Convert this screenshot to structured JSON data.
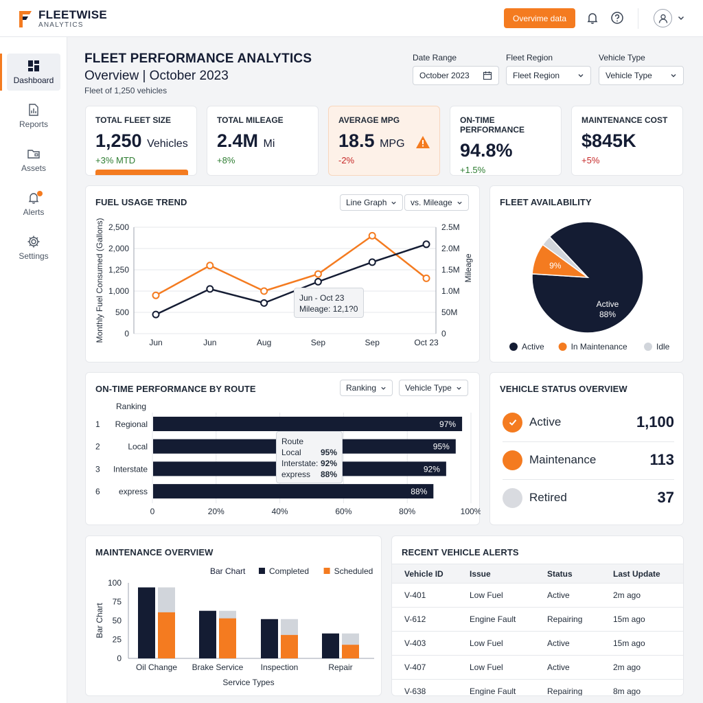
{
  "brand": {
    "name": "FLEETWISE",
    "sub": "ANALYTICS",
    "accent": "#f47b20",
    "navy": "#141c33"
  },
  "topbar": {
    "overview_button": "Overvime data",
    "icons": [
      "bell-icon",
      "help-icon",
      "user-icon",
      "chevron-down-icon"
    ]
  },
  "sidebar": {
    "items": [
      {
        "label": "Dashboard",
        "icon": "dashboard-icon",
        "active": true
      },
      {
        "label": "Reports",
        "icon": "reports-icon"
      },
      {
        "label": "Assets",
        "icon": "folder-icon"
      },
      {
        "label": "Alerts",
        "icon": "bell-icon"
      },
      {
        "label": "Settings",
        "icon": "gear-icon"
      }
    ]
  },
  "header": {
    "title": "FLEET PERFORMANCE ANALYTICS",
    "subtitle": "Overview | October 2023",
    "desc": "Fleet of 1,250 vehicles"
  },
  "filters": [
    {
      "label": "Date Range",
      "value": "October 2023",
      "icon": "calendar-icon"
    },
    {
      "label": "Fleet Region",
      "value": "Fleet Region",
      "icon": "chevron-down-icon"
    },
    {
      "label": "Vehicle Type",
      "value": "Vehicle Type",
      "icon": "chevron-down-icon"
    }
  ],
  "kpis": [
    {
      "label": "TOTAL FLEET SIZE",
      "value": "1,250",
      "unit": "Vehicles",
      "delta": "+3% MTD",
      "trend": "up"
    },
    {
      "label": "TOTAL MILEAGE",
      "value": "2.4M",
      "unit": "Mi",
      "delta": "+8%",
      "trend": "up"
    },
    {
      "label": "AVERAGE MPG",
      "value": "18.5",
      "unit": "MPG",
      "delta": "-2%",
      "trend": "down",
      "warning": true
    },
    {
      "label": "ON-TIME PERFORMANCE",
      "value": "94.8%",
      "unit": "",
      "delta": "+1.5%",
      "trend": "up"
    },
    {
      "label": "MAINTENANCE COST",
      "value": "$845K",
      "unit": "",
      "delta": "+5%",
      "trend": "down"
    }
  ],
  "fuel": {
    "title": "FUEL USAGE TREND",
    "select1": "Line Graph",
    "select2": "vs. Mileage",
    "tooltip_line1": "Jun - Oct 23",
    "tooltip_line2": "Mileage: 12,1?0"
  },
  "availability": {
    "title": "FLEET AVAILABILITY",
    "center_label": "Active",
    "center_pct": "88%",
    "slice_label": "9%"
  },
  "route": {
    "title": "ON-TIME PERFORMANCE BY ROUTE",
    "select1": "Ranking",
    "select2": "Vehicle Type",
    "tooltip": {
      "title": "Route",
      "rows": [
        {
          "name": "Local",
          "value": "95%"
        },
        {
          "name": "Interstate:",
          "value": "92%"
        },
        {
          "name": "express",
          "value": "88%"
        }
      ]
    }
  },
  "vehicle_status": {
    "title": "VEHICLE STATUS OVERVIEW",
    "rows": [
      {
        "label": "Active",
        "count": "1,100",
        "color": "#f47b20",
        "icon": "check-icon"
      },
      {
        "label": "Maintenance",
        "count": "113",
        "color": "#f47b20"
      },
      {
        "label": "Retired",
        "count": "37",
        "color": "#d1d5db"
      }
    ]
  },
  "maintenance": {
    "title": "MAINTENANCE OVERVIEW"
  },
  "alerts": {
    "title": "RECENT VEHICLE ALERTS",
    "columns": [
      "Vehicle ID",
      "Issue",
      "Status",
      "Last Update"
    ],
    "rows": [
      [
        "V-401",
        "Low Fuel",
        "Active",
        "2m ago"
      ],
      [
        "V-612",
        "Engine Fault",
        "Repairing",
        "15m ago"
      ],
      [
        "V-403",
        "Low Fuel",
        "Active",
        "15m ago"
      ],
      [
        "V-407",
        "Low Fuel",
        "Active",
        "2m ago"
      ],
      [
        "V-638",
        "Engine Fault",
        "Repairing",
        "8m ago"
      ]
    ]
  },
  "chart_data": [
    {
      "type": "line",
      "categories": [
        "Jun",
        "Jun",
        "Aug",
        "Sep",
        "Sep",
        "Oct 23"
      ],
      "series": [
        {
          "values": [
            900,
            1600,
            1000,
            1400,
            2300,
            1300
          ],
          "color": "#f47b20",
          "axis": "left"
        },
        {
          "values": [
            0.45,
            1.05,
            0.72,
            1.22,
            1.68,
            2.1
          ],
          "color": "#141c33",
          "axis": "right"
        }
      ],
      "ylabel": "Monthly Fuel Consumed (Gallons)",
      "y2label": "Mileage",
      "ylim": [
        0,
        2500
      ],
      "yticks": [
        "0",
        "500",
        "1,000",
        "1,250",
        "2,000",
        "2,500"
      ],
      "y2lim": [
        0,
        2.5
      ],
      "y2ticks": [
        "0",
        "50M",
        "1.0M",
        "1.5M",
        "2.0M",
        "2.5M"
      ],
      "grid": true
    },
    {
      "type": "pie",
      "slices": [
        {
          "name": "Active",
          "value": 88,
          "color": "#141c33"
        },
        {
          "name": "In Maintenance",
          "value": 9,
          "color": "#f47b20"
        },
        {
          "name": "Idle",
          "value": 3,
          "color": "#d1d5db"
        }
      ],
      "legend": "bottom"
    },
    {
      "type": "bar",
      "orientation": "horizontal",
      "header": "Ranking",
      "ranks": [
        "1",
        "2",
        "3",
        "6"
      ],
      "categories": [
        "Regional",
        "Local",
        "Interstate",
        "express"
      ],
      "values": [
        97,
        95,
        92,
        88
      ],
      "labels": [
        "97%",
        "95%",
        "92%",
        "88%"
      ],
      "xlim": [
        0,
        100
      ],
      "xticks": [
        "0",
        "20%",
        "40%",
        "60%",
        "80%",
        "100%"
      ],
      "grid": true
    },
    {
      "type": "bar",
      "stacked": true,
      "chart_label": "Bar Chart",
      "categories": [
        "Oil Change",
        "Brake Service",
        "Inspection",
        "Repair"
      ],
      "series": [
        {
          "name": "Completed",
          "values": [
            94,
            63,
            52,
            33
          ],
          "color": "#141c33"
        },
        {
          "name": "Scheduled",
          "values": [
            61,
            53,
            31,
            18
          ],
          "color": "#f47b20",
          "total": [
            94,
            63,
            52,
            33
          ]
        }
      ],
      "xlabel": "Service Types",
      "ylabel": "Bar Chart",
      "ylim": [
        0,
        100
      ],
      "yticks": [
        "0",
        "25",
        "50",
        "75",
        "100"
      ],
      "legend": "top-right"
    }
  ]
}
